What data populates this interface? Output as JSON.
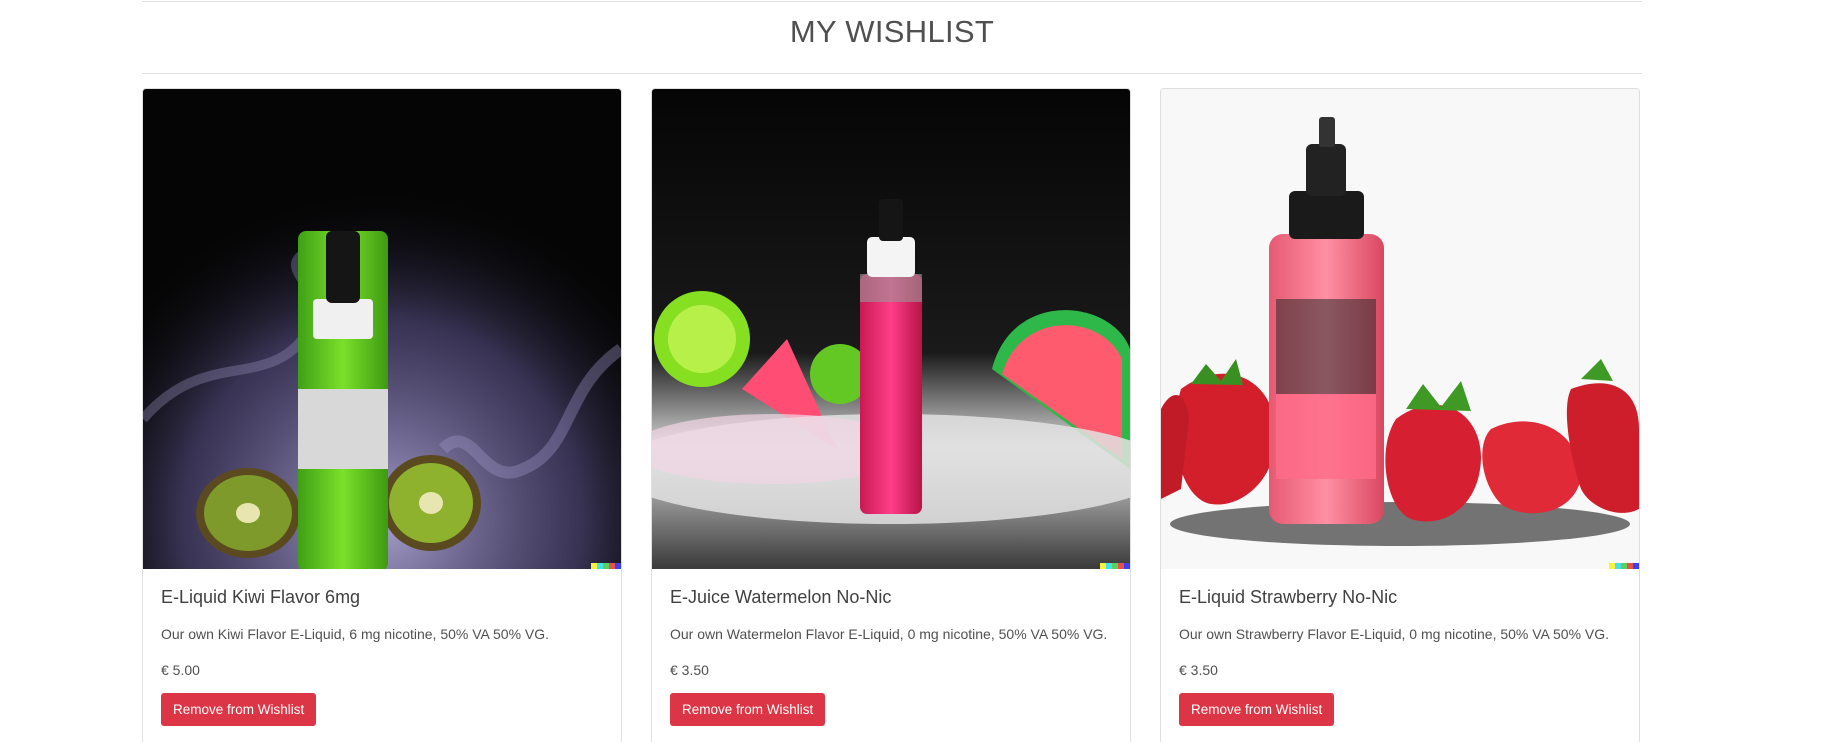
{
  "page": {
    "title": "MY WISHLIST"
  },
  "wishlist": [
    {
      "name": "E-Liquid Kiwi Flavor 6mg",
      "description": "Our own Kiwi Flavor E-Liquid, 6 mg nicotine, 50% VA 50% VG.",
      "price": "€ 5.00",
      "button_label": "Remove from Wishlist",
      "image_icon": "kiwi-eliquid-bottle-image"
    },
    {
      "name": "E-Juice Watermelon No-Nic",
      "description": "Our own Watermelon Flavor E-Liquid, 0 mg nicotine, 50% VA 50% VG.",
      "price": "€ 3.50",
      "button_label": "Remove from Wishlist",
      "image_icon": "watermelon-eliquid-bottle-image"
    },
    {
      "name": "E-Liquid Strawberry No-Nic",
      "description": "Our own Strawberry Flavor E-Liquid, 0 mg nicotine, 50% VA 50% VG.",
      "price": "€ 3.50",
      "button_label": "Remove from Wishlist",
      "image_icon": "strawberry-eliquid-bottle-image"
    }
  ],
  "colors": {
    "danger": "#dc3545",
    "text": "#505050",
    "border": "#dfdfdf"
  }
}
